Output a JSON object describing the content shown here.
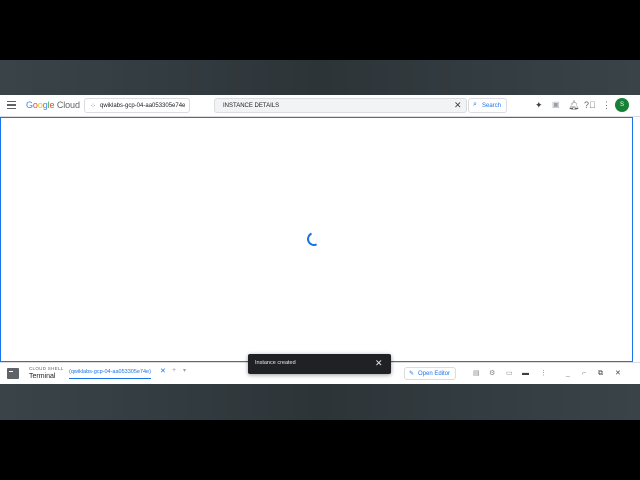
{
  "header": {
    "logo_google": "Google",
    "logo_cloud": "Cloud",
    "project": "qwiklabs-gcp-04-aa053305e74e",
    "search_value": "INSTANCE DETAILS",
    "search_button": "Search",
    "avatar_initial": "S"
  },
  "cloud_shell": {
    "label": "CLOUD SHELL",
    "title": "Terminal",
    "tab": "(qwiklabs-gcp-04-aa053305e74e)",
    "open_editor": "Open Editor"
  },
  "toast": {
    "message": "Instance created"
  },
  "colors": {
    "accent": "#1a73e8",
    "avatar": "#188038",
    "toast_bg": "#202124"
  }
}
